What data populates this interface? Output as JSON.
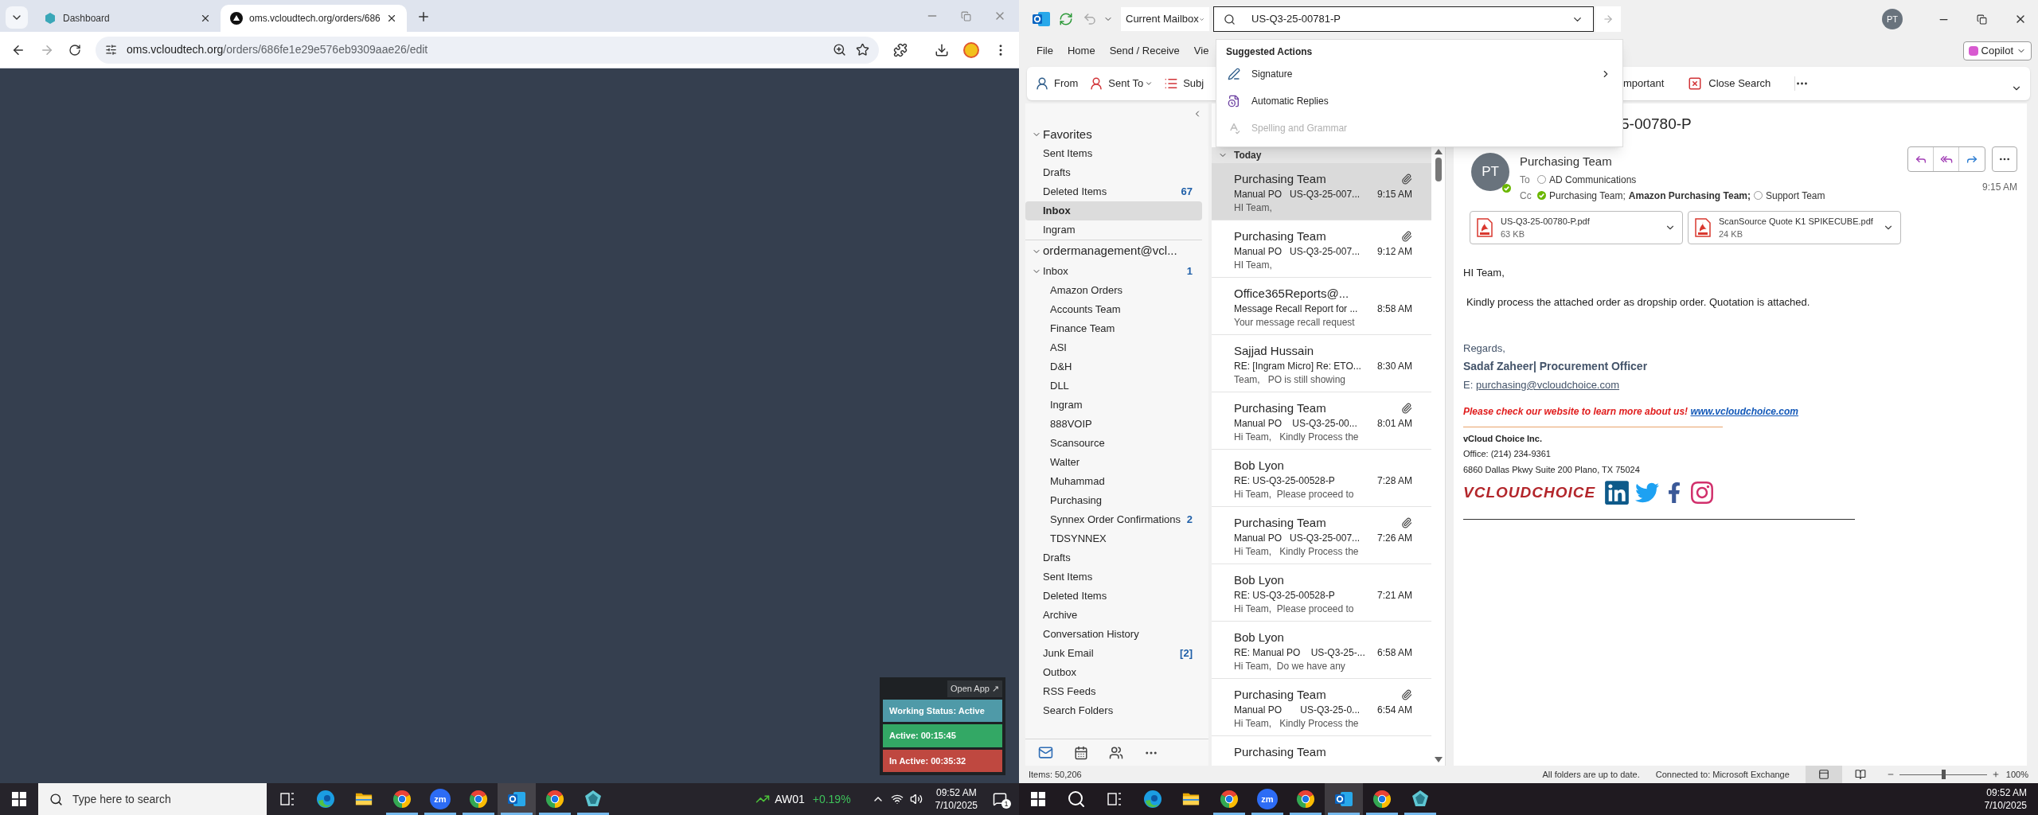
{
  "browser": {
    "tabs": [
      {
        "title": "Dashboard",
        "kind": "dashboard",
        "selected": false
      },
      {
        "title": "oms.vcloudtech.org/orders/686",
        "kind": "oms",
        "selected": true
      }
    ],
    "url_host": "oms.vcloudtech.org",
    "url_path": "/orders/686fe1e29e576eb9309aae26/edit"
  },
  "time_tracker": {
    "open_app": "Open App ↗",
    "working_status": "Working Status: Active",
    "active": "Active: 00:15:45",
    "inactive": "In Active: 00:35:32"
  },
  "left_taskbar": {
    "search_placeholder": "Type here to search",
    "apps": [
      {
        "kind": "task-view",
        "running": false,
        "active": false
      },
      {
        "kind": "edge",
        "running": false,
        "active": false
      },
      {
        "kind": "explorer",
        "running": false,
        "active": false
      },
      {
        "kind": "chrome",
        "running": true,
        "active": false
      },
      {
        "kind": "zoom",
        "label": "zm",
        "running": true,
        "active": false
      },
      {
        "kind": "chrome",
        "running": true,
        "active": false
      },
      {
        "kind": "outlook",
        "running": true,
        "active": true
      },
      {
        "kind": "chrome",
        "running": true,
        "active": false
      },
      {
        "kind": "app",
        "running": true,
        "active": false
      }
    ],
    "stock": {
      "symbol": "AW01",
      "change": "+0.19%"
    },
    "time": "09:52 AM",
    "date": "7/10/2025",
    "notifications": "1"
  },
  "outlook": {
    "scope": "Current Mailbox",
    "search_value": "US-Q3-25-00781-P",
    "avatar": "PT",
    "copilot": "Copilot",
    "menu": [
      "File",
      "Home",
      "Send / Receive",
      "Vie"
    ],
    "ribbon_left": [
      {
        "label": "From",
        "kind": "from",
        "menu": false
      },
      {
        "label": "Sent To",
        "kind": "sent-to",
        "menu": true
      },
      {
        "label": "Subj",
        "kind": "subject",
        "menu": false
      }
    ],
    "ribbon_right": [
      {
        "label": "mportant",
        "kind": "important",
        "menu": false
      },
      {
        "label": "Close Search",
        "kind": "close-search",
        "menu": false
      }
    ],
    "suggestions": {
      "heading": "Suggested Actions",
      "items": [
        {
          "label": "Signature",
          "kind": "signature",
          "disabled": false,
          "submenu": true
        },
        {
          "label": "Automatic Replies",
          "kind": "auto-reply",
          "disabled": false,
          "submenu": false
        },
        {
          "label": "Spelling and Grammar",
          "kind": "spelling",
          "disabled": true,
          "submenu": false
        }
      ]
    },
    "favorites": {
      "label": "Favorites",
      "expanded": true,
      "items": [
        {
          "label": "Sent Items",
          "selected": false
        },
        {
          "label": "Drafts",
          "selected": false
        },
        {
          "label": "Deleted Items",
          "count": "67",
          "selected": false
        },
        {
          "label": "Inbox",
          "selected": true
        },
        {
          "label": "Ingram",
          "selected": false
        }
      ]
    },
    "account": {
      "label": "ordermanagement@vcl...",
      "expanded": true,
      "folders": [
        {
          "label": "Inbox",
          "count": "1",
          "selected": false,
          "expanded": true,
          "children": [
            {
              "label": "Amazon Orders",
              "selected": false
            },
            {
              "label": "Accounts Team",
              "selected": false
            },
            {
              "label": "Finance Team",
              "selected": false
            },
            {
              "label": "ASI",
              "selected": false
            },
            {
              "label": "D&H",
              "selected": false
            },
            {
              "label": "DLL",
              "selected": false
            },
            {
              "label": "Ingram",
              "selected": false
            },
            {
              "label": "888VOIP",
              "selected": false
            },
            {
              "label": "Scansource",
              "selected": false
            },
            {
              "label": "Walter",
              "selected": false
            },
            {
              "label": "Muhammad",
              "selected": false
            },
            {
              "label": "Purchasing",
              "selected": false
            },
            {
              "label": "Synnex Order Confirmations",
              "count": "2",
              "selected": false
            },
            {
              "label": "TDSYNNEX",
              "selected": false
            }
          ]
        },
        {
          "label": "Drafts",
          "selected": false
        },
        {
          "label": "Sent Items",
          "selected": false
        },
        {
          "label": "Deleted Items",
          "selected": false
        },
        {
          "label": "Archive",
          "selected": false
        },
        {
          "label": "Conversation History",
          "selected": false
        },
        {
          "label": "Junk Email",
          "count": "[2]",
          "selected": false
        },
        {
          "label": "Outbox",
          "selected": false
        },
        {
          "label": "RSS Feeds",
          "selected": false
        },
        {
          "label": "Search Folders",
          "selected": false
        }
      ]
    },
    "group": {
      "label": "Today",
      "expanded": true
    },
    "messages": [
      {
        "sender": "Purchasing Team",
        "subject": "Manual PO   US-Q3-25-007...",
        "preview": "HI Team,",
        "time": "9:15 AM",
        "attachment": true,
        "selected": true
      },
      {
        "sender": "Purchasing Team",
        "subject": "Manual PO   US-Q3-25-007...",
        "preview": "HI Team,",
        "time": "9:12 AM",
        "attachment": true,
        "selected": false
      },
      {
        "sender": "Office365Reports@...",
        "subject": "Message Recall Report for ...",
        "preview": "Your message recall request",
        "time": "8:58 AM",
        "attachment": false,
        "selected": false
      },
      {
        "sender": "Sajjad Hussain",
        "subject": "RE: [Ingram Micro] Re: ETO...",
        "preview": "Team,   PO is still showing",
        "time": "8:30 AM",
        "attachment": false,
        "selected": false
      },
      {
        "sender": "Purchasing Team",
        "subject": "Manual PO    US-Q3-25-00...",
        "preview": "Hi Team,   Kindly Process the",
        "time": "8:01 AM",
        "attachment": true,
        "selected": false
      },
      {
        "sender": "Bob Lyon",
        "subject": "RE: US-Q3-25-00528-P",
        "preview": "Hi Team,  Please proceed to",
        "time": "7:28 AM",
        "attachment": false,
        "selected": false
      },
      {
        "sender": "Purchasing Team",
        "subject": "Manual PO   US-Q3-25-007...",
        "preview": "Hi Team,   Kindly Process the",
        "time": "7:26 AM",
        "attachment": true,
        "selected": false
      },
      {
        "sender": "Bob Lyon",
        "subject": "RE: US-Q3-25-00528-P",
        "preview": "Hi Team,  Please proceed to",
        "time": "7:21 AM",
        "attachment": false,
        "selected": false
      },
      {
        "sender": "Bob Lyon",
        "subject": "RE: Manual PO    US-Q3-25-...",
        "preview": "Hi Team,  Do we have any",
        "time": "6:58 AM",
        "attachment": false,
        "selected": false
      },
      {
        "sender": "Purchasing Team",
        "subject": "Manual PO       US-Q3-25-0...",
        "preview": "Hi Team,   Kindly Process the",
        "time": "6:54 AM",
        "attachment": true,
        "selected": false
      },
      {
        "sender": "Purchasing Team",
        "attachment": false,
        "selected": false
      }
    ],
    "reading": {
      "subject": "5-00780-P",
      "sender": "Purchasing Team",
      "avatar": "PT",
      "online": true,
      "to_label": "To",
      "to": [
        {
          "name": "AD Communications",
          "kind": "unknown",
          "bold": false
        }
      ],
      "cc_label": "Cc",
      "cc": [
        {
          "name": "Purchasing Team;",
          "kind": "available",
          "bold": false
        },
        {
          "name": "Amazon Purchasing Team;",
          "kind": "plain",
          "bold": true
        },
        {
          "name": "Support Team",
          "kind": "unknown",
          "bold": false
        }
      ],
      "time": "9:15 AM",
      "attachments": [
        {
          "name": "US-Q3-25-00780-P.pdf",
          "size": "63 KB"
        },
        {
          "name": "ScanSource Quote K1 SPIKECUBE.pdf",
          "size": "24 KB"
        }
      ],
      "greeting": "HI Team,",
      "body": "Kindly process the attached order as dropship order. Quotation is attached.",
      "regards": "Regards,",
      "signer": "Sadaf Zaheer| Procurement Officer",
      "email_label": "E:",
      "email": "purchasing@vcloudchoice.com",
      "promo": "Please check our website to learn more about us!",
      "website": "www.vcloudchoice.com",
      "company": "vCloud Choice Inc.",
      "office": "Office: (214) 234-9361",
      "address": "6860 Dallas Pkwy Suite 200 Plano, TX 75024",
      "logo_text": "VCLOUDCHOICE",
      "socials": [
        {
          "kind": "linkedin"
        },
        {
          "kind": "twitter"
        },
        {
          "kind": "facebook"
        },
        {
          "kind": "instagram"
        }
      ]
    },
    "status_bar": {
      "items": "Items: 50,206",
      "sync": "All folders are up to date.",
      "connection": "Connected to: Microsoft Exchange",
      "views": [
        {
          "kind": "normal",
          "selected": true
        },
        {
          "kind": "reading",
          "selected": false
        }
      ],
      "zoom": {
        "level": 0.5,
        "label": "100%"
      }
    }
  },
  "right_taskbar": {
    "apps": [
      {
        "kind": "search",
        "running": false,
        "active": false
      },
      {
        "kind": "task-view",
        "running": false,
        "active": false
      },
      {
        "kind": "edge",
        "running": false,
        "active": false
      },
      {
        "kind": "explorer",
        "running": false,
        "active": false
      },
      {
        "kind": "chrome",
        "running": true,
        "active": false
      },
      {
        "kind": "zoom",
        "label": "zm",
        "running": true,
        "active": false
      },
      {
        "kind": "chrome",
        "running": true,
        "active": false
      },
      {
        "kind": "outlook",
        "running": true,
        "active": true
      },
      {
        "kind": "chrome",
        "running": true,
        "active": false
      },
      {
        "kind": "app",
        "running": true,
        "active": false
      }
    ],
    "time": "09:52 AM",
    "date": "7/10/2025"
  }
}
